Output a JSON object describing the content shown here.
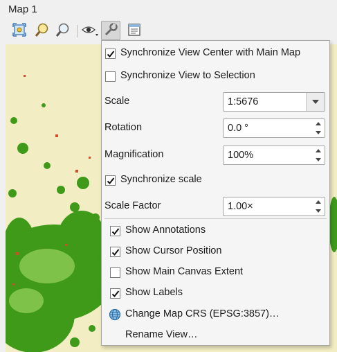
{
  "window": {
    "title": "Map 1"
  },
  "toolbar": {
    "buttons": [
      {
        "name": "zoom-full-icon"
      },
      {
        "name": "zoom-to-selection-icon"
      },
      {
        "name": "zoom-to-layer-icon"
      },
      {
        "name": "view-theme-icon"
      },
      {
        "name": "wrench-icon"
      },
      {
        "name": "map-settings-icon"
      }
    ]
  },
  "menu": {
    "sync_center": {
      "label": "Synchronize View Center with Main Map",
      "checked": true
    },
    "sync_selection": {
      "label": "Synchronize View to Selection",
      "checked": false
    },
    "scale": {
      "label": "Scale",
      "value": "1:5676"
    },
    "rotation": {
      "label": "Rotation",
      "value": "0.0 °"
    },
    "magnification": {
      "label": "Magnification",
      "value": "100%"
    },
    "sync_scale": {
      "label": "Synchronize scale",
      "checked": true
    },
    "scale_factor": {
      "label": "Scale Factor",
      "value": "1.00×"
    },
    "show_annotations": {
      "label": "Show Annotations",
      "checked": true
    },
    "show_cursor": {
      "label": "Show Cursor Position",
      "checked": true
    },
    "show_extent": {
      "label": "Show Main Canvas Extent",
      "checked": false
    },
    "show_labels": {
      "label": "Show Labels",
      "checked": true
    },
    "change_crs": {
      "label": "Change Map CRS (EPSG:3857)…",
      "icon": "globe-icon"
    },
    "rename_view": {
      "label": "Rename View…"
    }
  },
  "colors": {
    "map_bg": "#f3edc3",
    "vegetation": "#3f9a1a",
    "accent_red": "#d94a2a"
  }
}
